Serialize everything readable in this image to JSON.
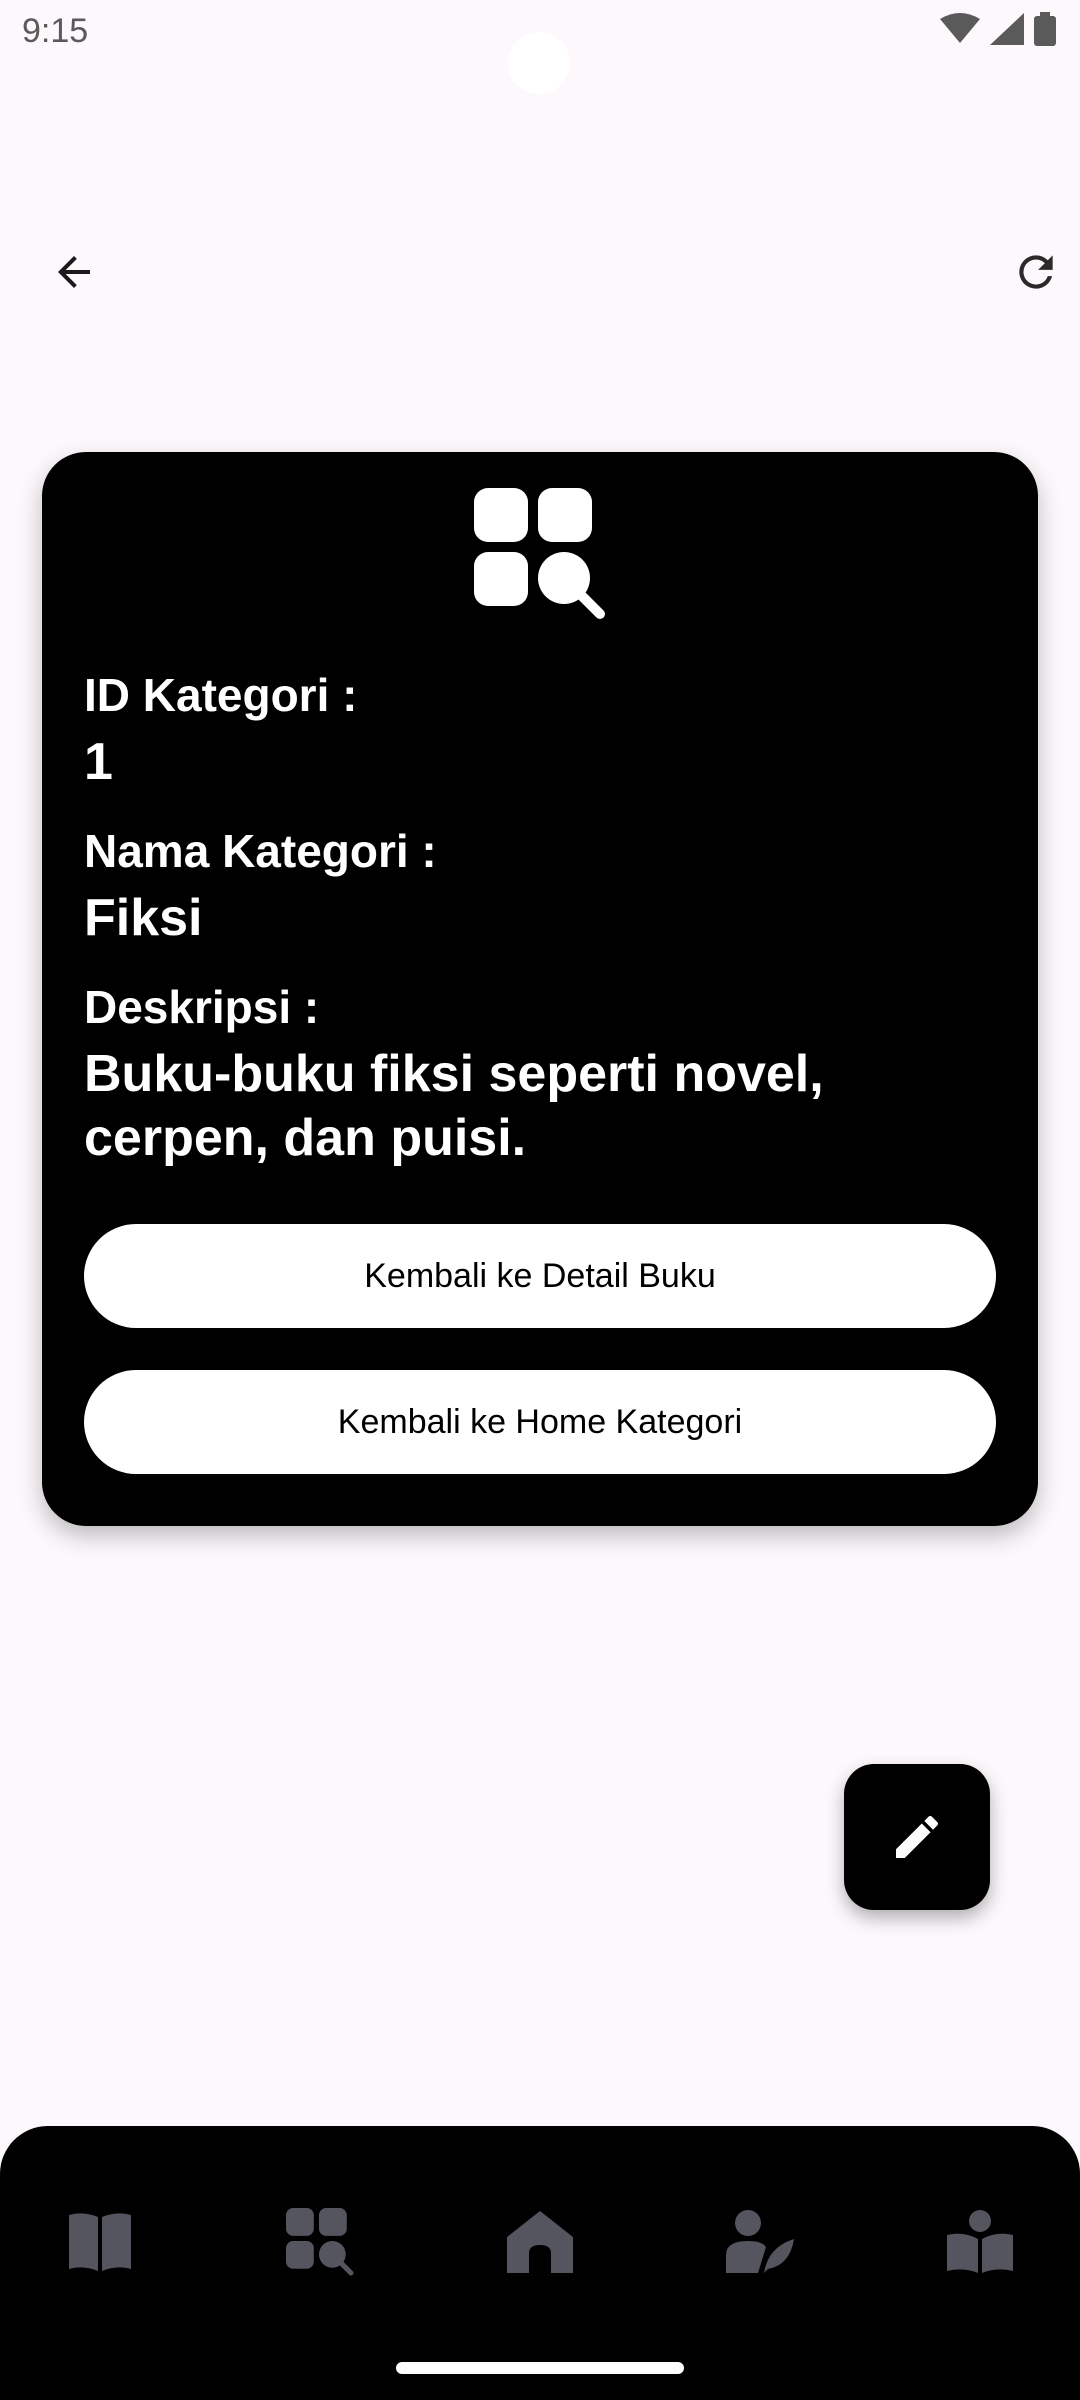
{
  "status": {
    "time": "9:15"
  },
  "topbar": {
    "back_icon": "arrow-back-icon",
    "refresh_icon": "refresh-icon"
  },
  "category": {
    "icon": "category-search-icon",
    "id_label": "ID Kategori :",
    "id_value": "1",
    "name_label": "Nama Kategori :",
    "name_value": "Fiksi",
    "desc_label": "Deskripsi :",
    "desc_value": "Buku-buku fiksi seperti novel, cerpen, dan puisi."
  },
  "buttons": {
    "back_to_book_detail": "Kembali ke Detail Buku",
    "back_to_category_home": "Kembali ke Home Kategori"
  },
  "fab": {
    "icon": "edit-pencil-icon"
  },
  "bottom_nav": {
    "items": [
      {
        "icon": "book-open-icon"
      },
      {
        "icon": "category-search-icon"
      },
      {
        "icon": "home-icon"
      },
      {
        "icon": "author-writer-icon"
      },
      {
        "icon": "reader-book-icon"
      }
    ],
    "icon_color": "#55555f"
  },
  "colors": {
    "background": "#fcf8fc",
    "card": "#000000",
    "button_bg": "#ffffff"
  }
}
